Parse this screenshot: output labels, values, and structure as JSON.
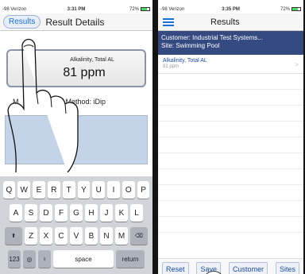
{
  "left_screen": {
    "status": {
      "carrier": "-98 Verizon",
      "time": "3:31 PM",
      "battery": "72%"
    },
    "nav": {
      "back_label": "Results",
      "title": "Result Details"
    },
    "result_card": {
      "label": "Alkalinity, Total AL",
      "value": "81 ppm"
    },
    "input_method": {
      "prefix": "M",
      "text": "Input Method: iDip"
    },
    "keyboard": {
      "row1": [
        "Q",
        "W",
        "E",
        "R",
        "T",
        "Y",
        "U",
        "I",
        "O",
        "P"
      ],
      "row2": [
        "A",
        "S",
        "D",
        "F",
        "G",
        "H",
        "J",
        "K",
        "L"
      ],
      "row3": [
        "Z",
        "X",
        "C",
        "V",
        "B",
        "N",
        "M"
      ],
      "numbers_key": "123",
      "space_key": "space",
      "return_key": "return"
    }
  },
  "right_screen": {
    "status": {
      "carrier": "-98 Verizon",
      "time": "3:35 PM",
      "battery": "72%"
    },
    "nav": {
      "title": "Results"
    },
    "customer_header": {
      "customer": "Customer: Industrial Test Systems...",
      "site": "Site: Swimming Pool"
    },
    "results": [
      {
        "name": "Alkalinity, Total AL",
        "value": "81 ppm"
      }
    ],
    "toolbar": {
      "reset": "Reset",
      "save": "Save",
      "customer": "Customer",
      "sites": "Sites"
    }
  },
  "colors": {
    "accent": "#1a6fd8",
    "header_bg": "#344a80",
    "notes_bg": "#c5d3e8",
    "keyboard_bg": "#d1d4d9"
  }
}
